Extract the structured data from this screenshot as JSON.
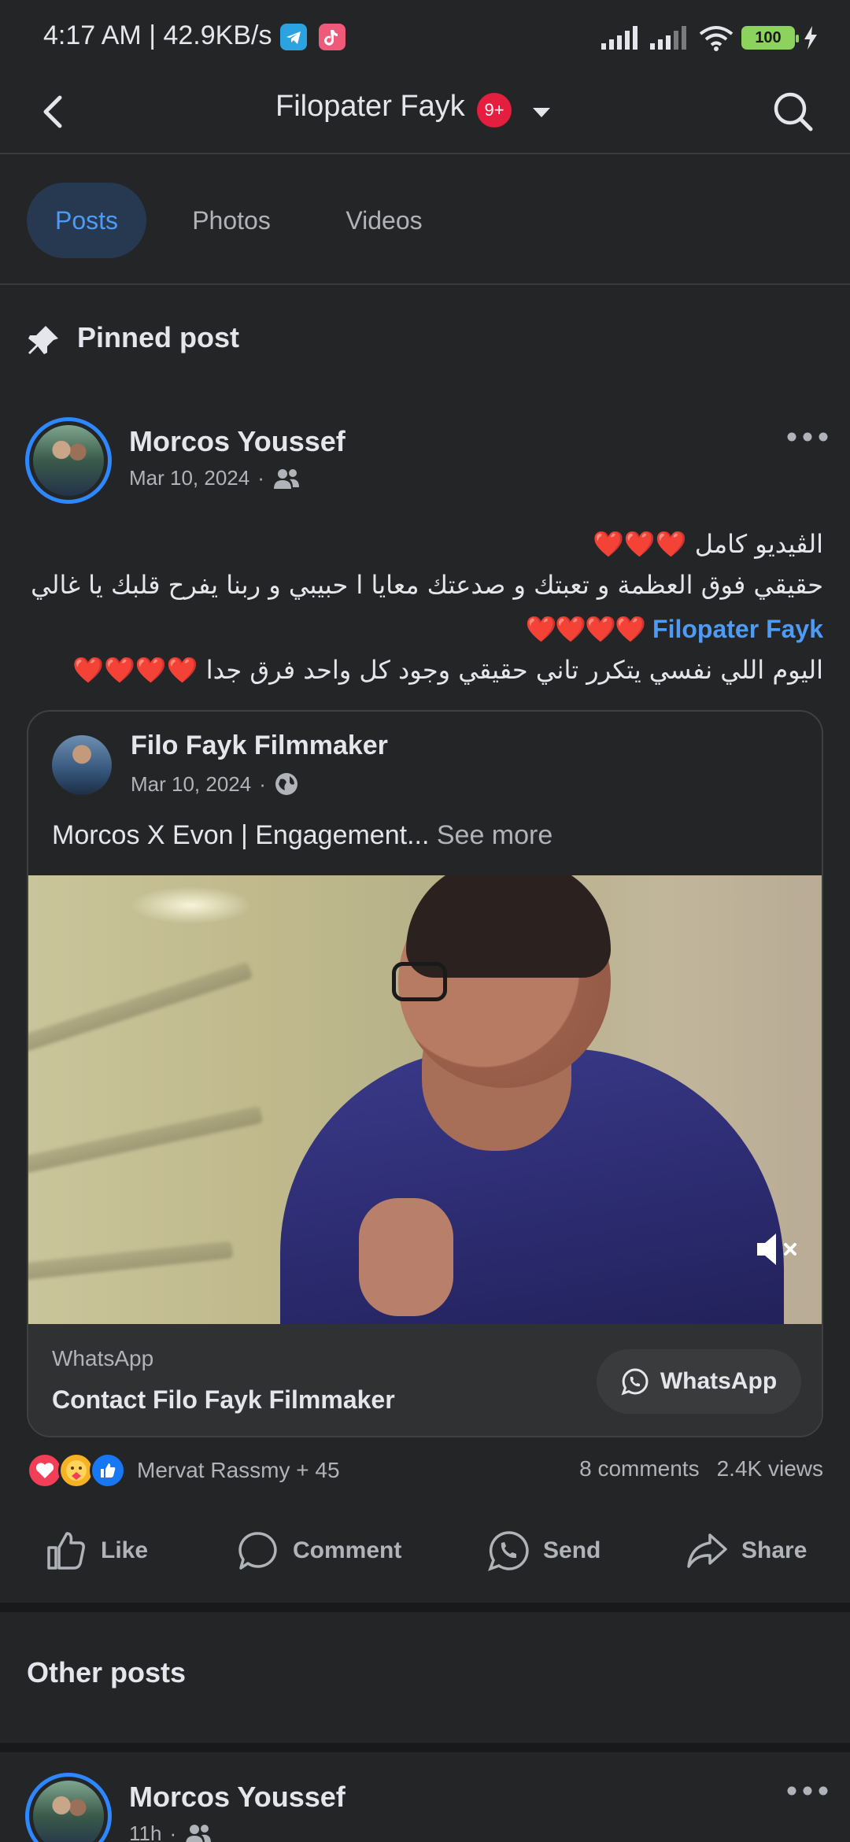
{
  "status_bar": {
    "time_speed": "4:17 AM | 42.9KB/s",
    "battery": "100",
    "app_icons": [
      "telegram-icon",
      "tiktok-icon"
    ]
  },
  "header": {
    "title": "Filopater Fayk",
    "badge": "9+"
  },
  "tabs": [
    {
      "label": "Posts",
      "active": true
    },
    {
      "label": "Photos",
      "active": false
    },
    {
      "label": "Videos",
      "active": false
    }
  ],
  "pinned_section": {
    "title": "Pinned post"
  },
  "pinned_post": {
    "author": "Morcos Youssef",
    "date": "Mar 10, 2024",
    "dot": "·",
    "audience_icon": "friends-icon",
    "text_line1": "الڤيديو كامل",
    "text_line1_hearts": "❤️❤️❤️",
    "text_line2": "حقيقي فوق العظمة و تعبتك و صدعتك معايا ا حبيبي و ربنا يفرح قلبك يا غالي",
    "text_line3_mention": "Filopater Fayk",
    "text_line3_hearts": "❤️❤️❤️❤️",
    "text_line4": "اليوم اللي نفسي يتكرر تاني حقيقي وجود كل واحد فرق جدا",
    "text_line4_hearts": "❤️❤️❤️❤️",
    "shared": {
      "author": "Filo Fayk Filmmaker",
      "date": "Mar 10, 2024",
      "dot": "·",
      "audience_icon": "globe-icon",
      "caption": "Morcos X Evon | Engagement...",
      "see_more": "See more",
      "cta_label": "WhatsApp",
      "cta_title": "Contact Filo Fayk Filmmaker",
      "cta_button": "WhatsApp"
    },
    "reactions_text": "Mervat Rassmy + 45",
    "comments": "8 comments",
    "views": "2.4K views",
    "actions": [
      "Like",
      "Comment",
      "Send",
      "Share"
    ]
  },
  "other_section": {
    "title": "Other posts"
  },
  "other_post": {
    "author": "Morcos Youssef",
    "time": "11h",
    "dot": "·"
  }
}
